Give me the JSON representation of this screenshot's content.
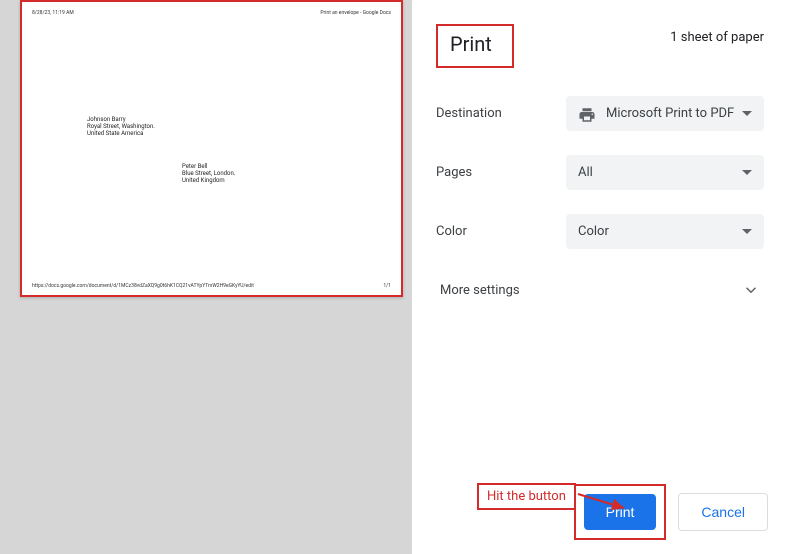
{
  "preview": {
    "timestamp": "8/28/23, 11:19 AM",
    "doc_title": "Print an envelope - Google Docs",
    "return_address": {
      "line1": "Johnson Barry",
      "line2": "Royal Street, Washington.",
      "line3": "United State America"
    },
    "recipient_address": {
      "line1": "Peter Bell",
      "line2": "Blue Street, London.",
      "line3": "United Kingdom"
    },
    "footer_url": "https://docs.google.com/document/d/1MCz38vdZaXQ9g0t6hK1CQ21vATYpYTmW2H9eGKyYU/edit",
    "page_num": "1/1"
  },
  "header": {
    "title": "Print",
    "sheet_count": "1 sheet of paper"
  },
  "destination": {
    "label": "Destination",
    "value": "Microsoft Print to PDF"
  },
  "pages": {
    "label": "Pages",
    "value": "All"
  },
  "color": {
    "label": "Color",
    "value": "Color"
  },
  "more_settings": {
    "label": "More settings"
  },
  "buttons": {
    "print": "Print",
    "cancel": "Cancel"
  },
  "annotations": {
    "hit_label": "Hit the button"
  }
}
